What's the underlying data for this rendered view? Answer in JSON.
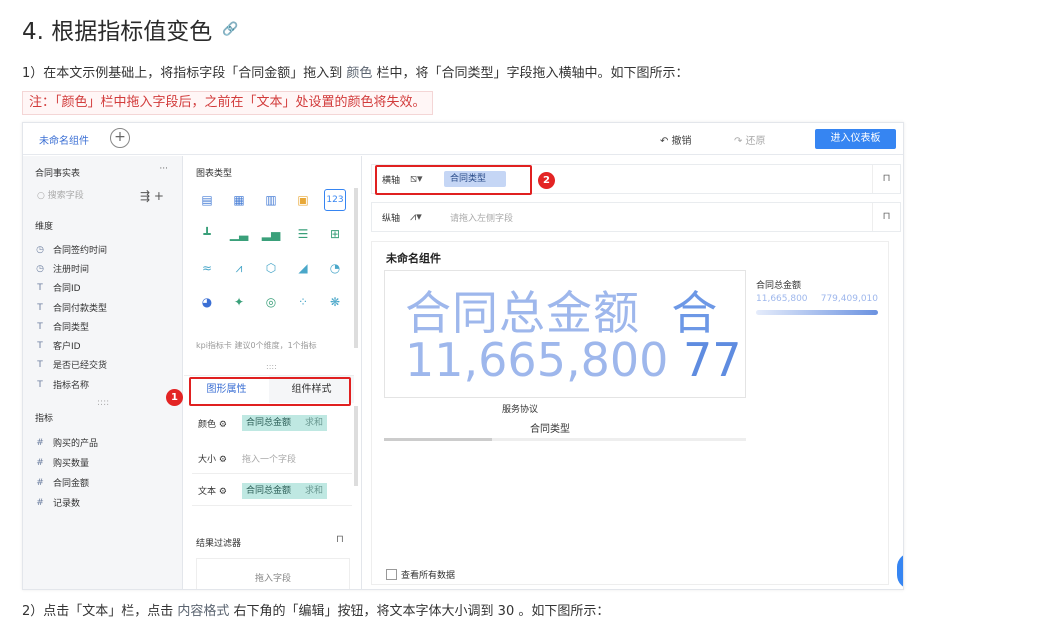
{
  "heading": {
    "title": "4. 根据指标值变色",
    "link_icon": "🔗"
  },
  "p1": {
    "before": "1）在本文示例基础上，将指标字段「合同金额」拖入到 ",
    "highlight": "颜色",
    "after": " 栏中，将「合同类型」字段拖入横轴中。如下图所示："
  },
  "note": "注：「颜色」栏中拖入字段后，之前在「文本」处设置的颜色将失效。",
  "p2": {
    "before": "2）点击「文本」栏，点击 ",
    "highlight": "内容格式",
    "after": " 右下角的「编辑」按钮，将文本字体大小调到 30 。如下图所示："
  },
  "topbar": {
    "tab": "未命名组件",
    "plus": "+",
    "undo": "↶ 撤销",
    "redo": "↷ 还原",
    "enter": "进入仪表板"
  },
  "left": {
    "title": "合同事实表",
    "dots": "···",
    "search_placeholder": "搜索字段",
    "dim_label": "维度",
    "dimensions": [
      {
        "icon": "◷",
        "label": "合同签约时间"
      },
      {
        "icon": "◷",
        "label": "注册时间"
      },
      {
        "icon": "T",
        "label": "合同ID"
      },
      {
        "icon": "T",
        "label": "合同付款类型"
      },
      {
        "icon": "T",
        "label": "合同类型"
      },
      {
        "icon": "T",
        "label": "客户ID"
      },
      {
        "icon": "T",
        "label": "是否已经交货"
      },
      {
        "icon": "T",
        "label": "指标名称"
      }
    ],
    "handle": "::::",
    "metric_label": "指标",
    "metrics": [
      {
        "icon": "#",
        "label": "购买的产品"
      },
      {
        "icon": "#",
        "label": "购买数量"
      },
      {
        "icon": "#",
        "label": "合同金额"
      },
      {
        "icon": "#",
        "label": "记录数"
      }
    ]
  },
  "mid": {
    "title": "图表类型",
    "kpi_text": "kpi指标卡 建议0个维度，1个指标",
    "handle": "::::",
    "tab_active": "图形属性",
    "tab_other": "组件样式",
    "color_label": "颜色",
    "color_field": "合同总金额",
    "color_agg": "求和",
    "size_label": "大小",
    "size_placeholder": "拖入一个字段",
    "text_label": "文本",
    "text_field": "合同总金额",
    "text_agg": "求和",
    "filter_title": "结果过滤器",
    "filter_placeholder": "拖入字段"
  },
  "axes": {
    "x_label": "横轴",
    "x_field": "合同类型",
    "y_label": "纵轴",
    "y_placeholder": "请拖入左侧字段"
  },
  "canvas": {
    "title": "未命名组件",
    "big_line1": "合同总金额",
    "big_line1_b": "合",
    "big_line2": "11,665,800",
    "big_line2_b": "77",
    "x_value": "服务协议",
    "x_title": "合同类型",
    "legend_title": "合同总金额",
    "legend_min": "11,665,800",
    "legend_max": "779,409,010",
    "check_label": "查看所有数据"
  },
  "badges": {
    "b1": "1",
    "b2": "2"
  },
  "colors": {
    "accent": "#3685f2",
    "pill_dim": "#c5d6f5",
    "pill_metric": "#bfe8e2",
    "marker": "#e02020"
  }
}
